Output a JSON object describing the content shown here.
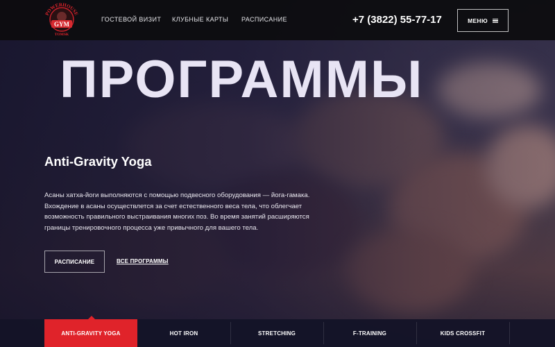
{
  "brand": {
    "logo_top_text": "POWERHOUSE",
    "logo_main_text": "GYM",
    "logo_bottom_text": "TOMSK",
    "accent_color": "#e0232a"
  },
  "header": {
    "nav": [
      "ГОСТЕВОЙ ВИЗИТ",
      "КЛУБНЫЕ КАРТЫ",
      "РАСПИСАНИЕ"
    ],
    "phone": "+7 (3822) 55-77-17",
    "menu_label": "МЕНЮ",
    "menu_icon": "hamburger-icon"
  },
  "hero": {
    "title": "ПРОГРАММЫ",
    "program_title": "Anti-Gravity Yoga",
    "description": "Асаны хатха-йоги выполняются с помощью подвесного оборудования — йога-гамака. Вхождение в асаны осуществлется за счет естественного веса тела, что облегчает возможность правильного выстраивания многих поз. Во время занятий расширяются границы тренировочного процесса уже привычного для вашего тела.",
    "schedule_button": "РАСПИСАНИЕ",
    "all_programs_link": "ВСЕ ПРОГРАММЫ"
  },
  "tabs": [
    {
      "label": "ANTI-GRAVITY YOGA",
      "active": true
    },
    {
      "label": "HOT IRON",
      "active": false
    },
    {
      "label": "STRETCHING",
      "active": false
    },
    {
      "label": "F-TRAINING",
      "active": false
    },
    {
      "label": "KIDS CROSSFIT",
      "active": false
    }
  ]
}
